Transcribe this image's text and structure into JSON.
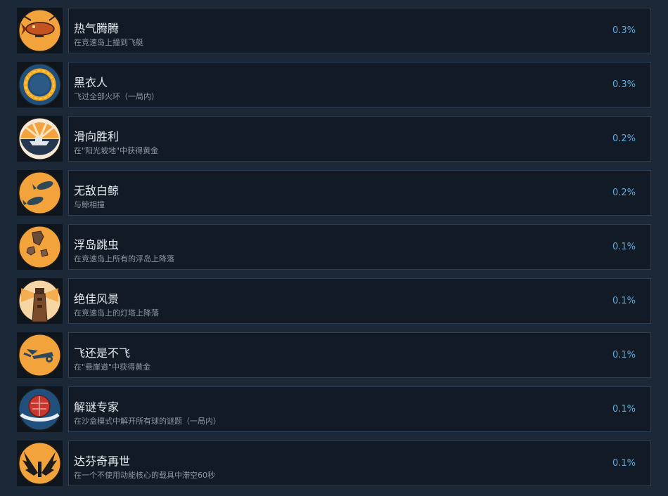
{
  "achievements": [
    {
      "title": "热气腾腾",
      "description": "在竞速岛上撞到飞艇",
      "percent": "0.3%",
      "icon": "blimp-icon"
    },
    {
      "title": "黑衣人",
      "description": "飞过全部火环（一局内）",
      "percent": "0.3%",
      "icon": "fire-ring-icon"
    },
    {
      "title": "滑向胜利",
      "description": "在\"阳光坡地\"中获得黄金",
      "percent": "0.2%",
      "icon": "sunset-boat-icon"
    },
    {
      "title": "无敌白鲸",
      "description": "与鲸相撞",
      "percent": "0.2%",
      "icon": "whale-icon"
    },
    {
      "title": "浮岛跳虫",
      "description": "在竞速岛上所有的浮岛上降落",
      "percent": "0.1%",
      "icon": "floating-rocks-icon"
    },
    {
      "title": "绝佳风景",
      "description": "在竞速岛上的灯塔上降落",
      "percent": "0.1%",
      "icon": "lighthouse-icon"
    },
    {
      "title": "飞还是不飞",
      "description": "在\"悬崖道\"中获得黄金",
      "percent": "0.1%",
      "icon": "flying-vehicle-icon"
    },
    {
      "title": "解谜专家",
      "description": "在沙盒模式中解开所有球的谜题（一局内）",
      "percent": "0.1%",
      "icon": "puzzle-ball-icon"
    },
    {
      "title": "达芬奇再世",
      "description": "在一个不使用动能核心的载具中滞空60秒",
      "percent": "0.1%",
      "icon": "wings-icon"
    }
  ]
}
